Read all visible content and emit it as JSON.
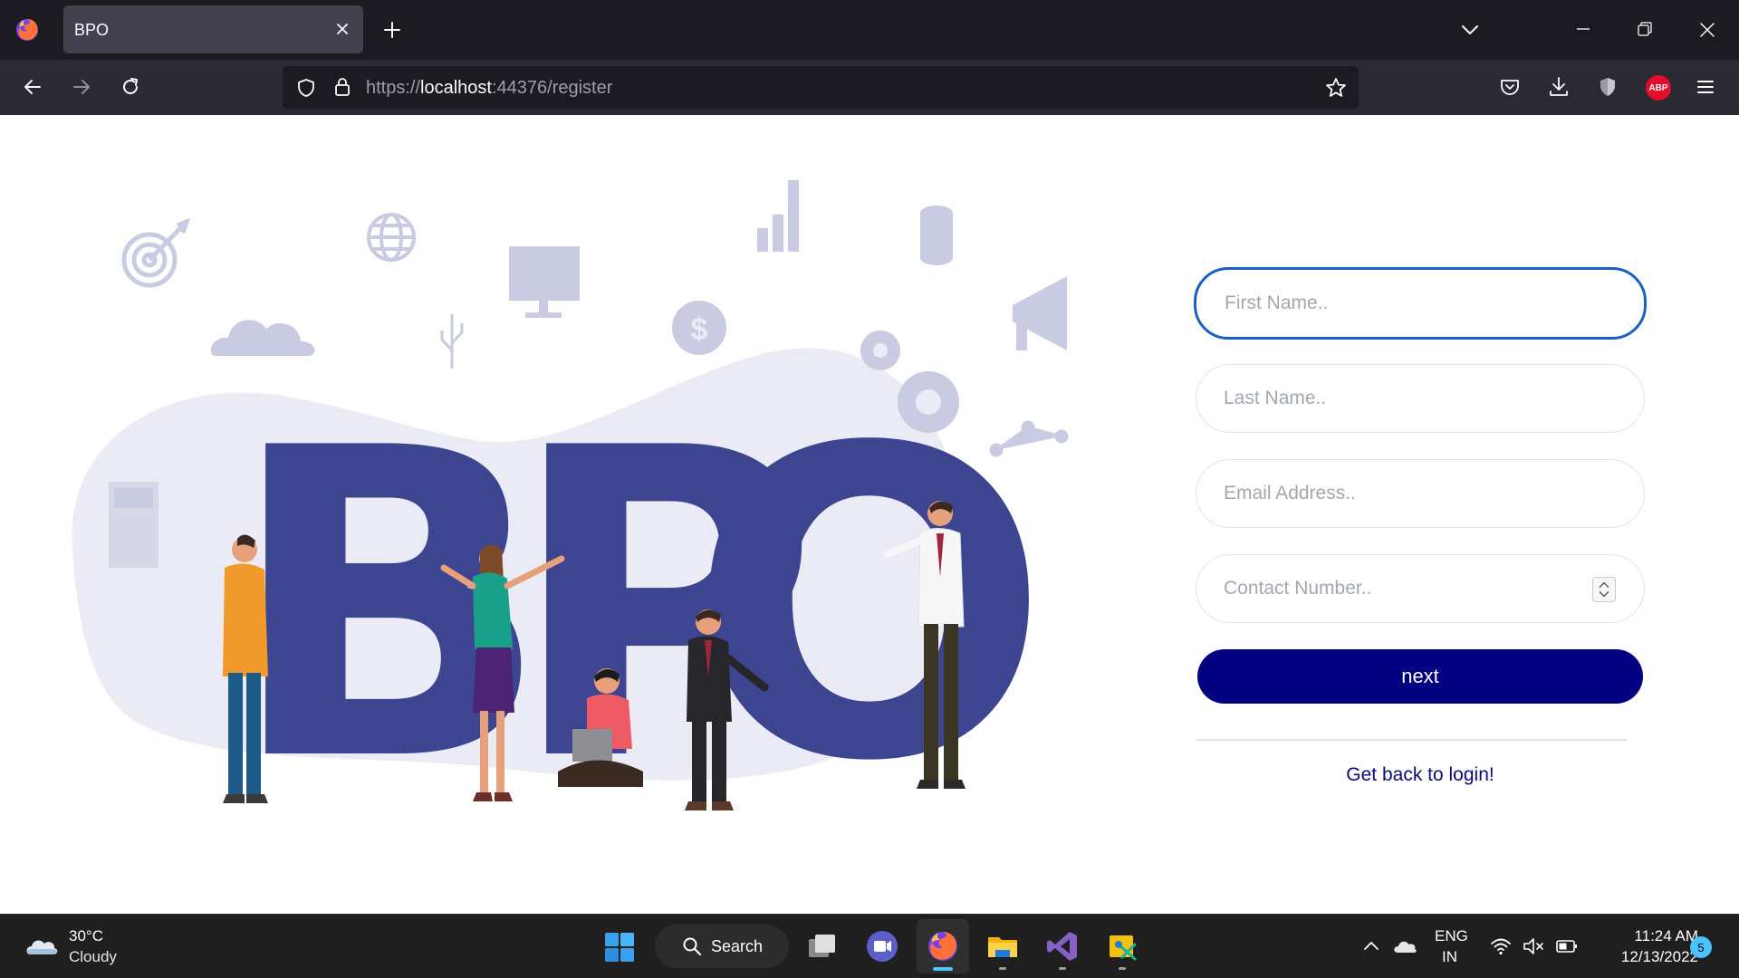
{
  "browser": {
    "tab_title": "BPO",
    "url_scheme": "https://",
    "url_host": "localhost",
    "url_rest": ":44376/register",
    "extension_badge": "ABP"
  },
  "illustration": {
    "letters": [
      "B",
      "P",
      "O"
    ],
    "colors": {
      "letters": "#3d4591",
      "blob": "#ebebf5",
      "icons": "#c8cbe1"
    }
  },
  "form": {
    "first_name_placeholder": "First Name..",
    "last_name_placeholder": "Last Name..",
    "email_placeholder": "Email Address..",
    "contact_placeholder": "Contact Number..",
    "next_label": "next",
    "login_link": "Get back to login!",
    "colors": {
      "button": "#010081",
      "focus": "#1a5fc9",
      "link": "#0b0b7a"
    }
  },
  "taskbar": {
    "weather_temp": "30°C",
    "weather_condition": "Cloudy",
    "search_label": "Search",
    "lang_line1": "ENG",
    "lang_line2": "IN",
    "time": "11:24 AM",
    "date": "12/13/2022",
    "notification_count": "5"
  }
}
